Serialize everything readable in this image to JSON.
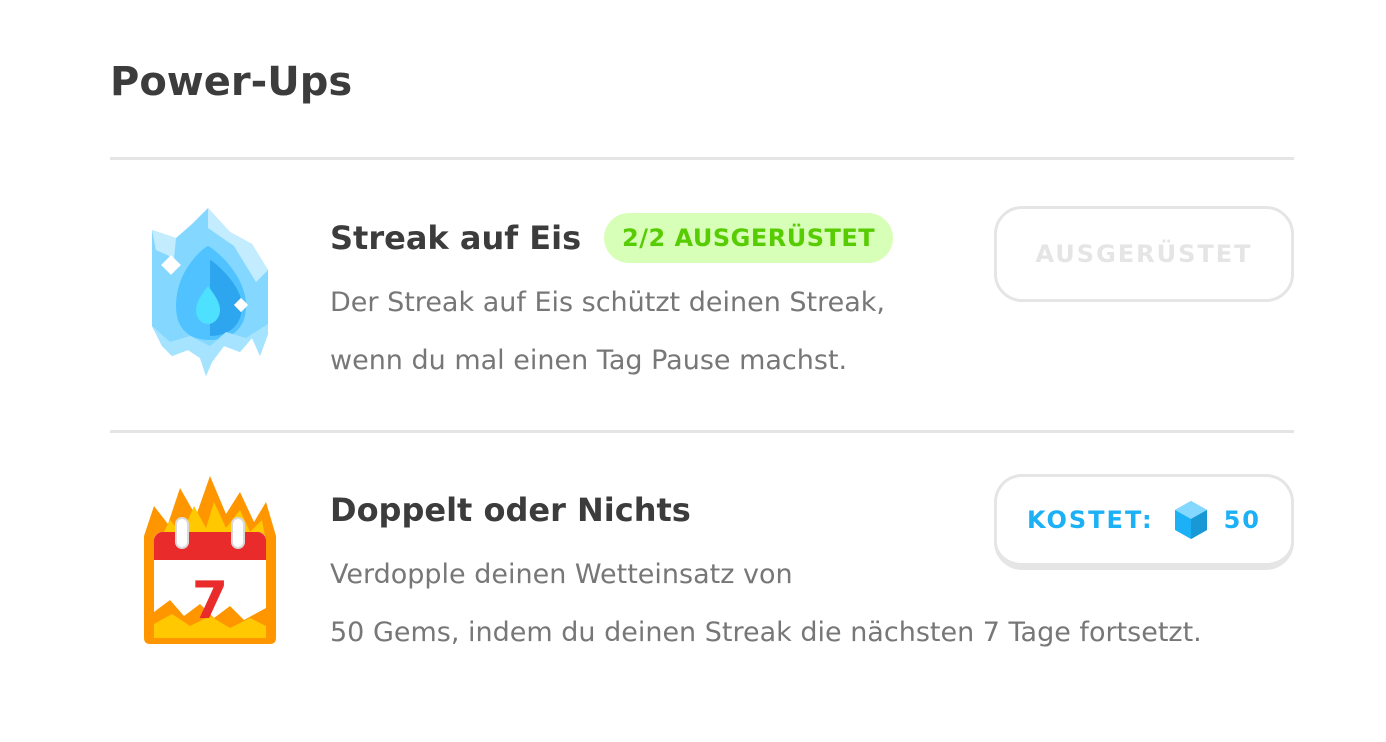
{
  "header": {
    "title": "Power-Ups"
  },
  "items": [
    {
      "title": "Streak auf Eis",
      "badge": "2/2 AUSGERÜSTET",
      "description_lines": [
        "Der Streak auf Eis schützt deinen Streak,",
        "wenn du mal einen Tag Pause machst."
      ],
      "button_label": "AUSGERÜSTET",
      "icon": "ice-crystal-icon"
    },
    {
      "title": "Doppelt oder Nichts",
      "description_lines": [
        "Verdopple deinen Wetteinsatz von",
        "50 Gems, indem du deinen Streak die nächsten 7 Tage fortsetzt."
      ],
      "button_label": "KOSTET:",
      "price": "50",
      "icon": "calendar-fire-icon",
      "calendar_day": "7",
      "currency_icon": "gem-icon"
    }
  ],
  "colors": {
    "title_text": "#3c3c3c",
    "body_text": "#777777",
    "divider": "#e5e5e5",
    "badge_bg": "#d7ffb8",
    "badge_text": "#58cc02",
    "accent_blue": "#1cb0f6",
    "disabled_text": "#e5e5e5"
  }
}
